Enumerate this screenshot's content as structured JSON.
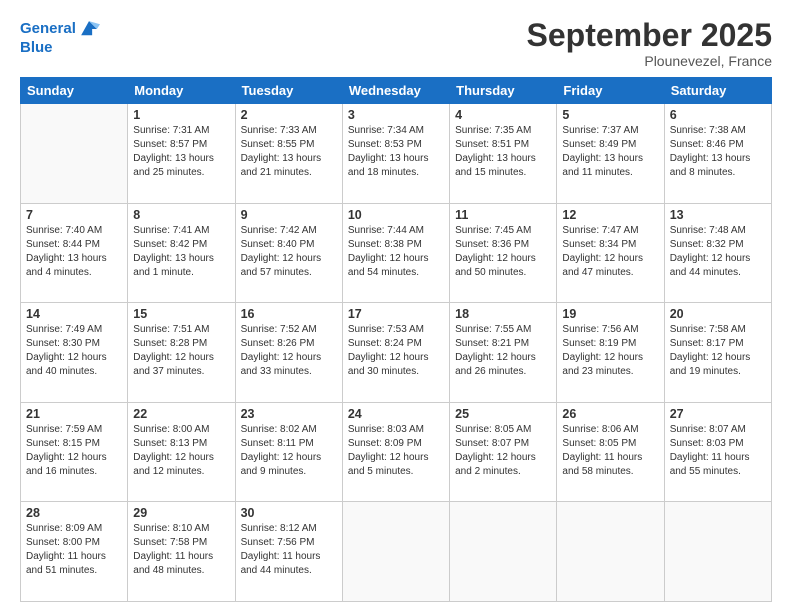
{
  "header": {
    "logo_line1": "General",
    "logo_line2": "Blue",
    "month": "September 2025",
    "location": "Plounevezel, France"
  },
  "days_of_week": [
    "Sunday",
    "Monday",
    "Tuesday",
    "Wednesday",
    "Thursday",
    "Friday",
    "Saturday"
  ],
  "weeks": [
    [
      {
        "day": "",
        "info": ""
      },
      {
        "day": "1",
        "info": "Sunrise: 7:31 AM\nSunset: 8:57 PM\nDaylight: 13 hours and 25 minutes."
      },
      {
        "day": "2",
        "info": "Sunrise: 7:33 AM\nSunset: 8:55 PM\nDaylight: 13 hours and 21 minutes."
      },
      {
        "day": "3",
        "info": "Sunrise: 7:34 AM\nSunset: 8:53 PM\nDaylight: 13 hours and 18 minutes."
      },
      {
        "day": "4",
        "info": "Sunrise: 7:35 AM\nSunset: 8:51 PM\nDaylight: 13 hours and 15 minutes."
      },
      {
        "day": "5",
        "info": "Sunrise: 7:37 AM\nSunset: 8:49 PM\nDaylight: 13 hours and 11 minutes."
      },
      {
        "day": "6",
        "info": "Sunrise: 7:38 AM\nSunset: 8:46 PM\nDaylight: 13 hours and 8 minutes."
      }
    ],
    [
      {
        "day": "7",
        "info": "Sunrise: 7:40 AM\nSunset: 8:44 PM\nDaylight: 13 hours and 4 minutes."
      },
      {
        "day": "8",
        "info": "Sunrise: 7:41 AM\nSunset: 8:42 PM\nDaylight: 13 hours and 1 minute."
      },
      {
        "day": "9",
        "info": "Sunrise: 7:42 AM\nSunset: 8:40 PM\nDaylight: 12 hours and 57 minutes."
      },
      {
        "day": "10",
        "info": "Sunrise: 7:44 AM\nSunset: 8:38 PM\nDaylight: 12 hours and 54 minutes."
      },
      {
        "day": "11",
        "info": "Sunrise: 7:45 AM\nSunset: 8:36 PM\nDaylight: 12 hours and 50 minutes."
      },
      {
        "day": "12",
        "info": "Sunrise: 7:47 AM\nSunset: 8:34 PM\nDaylight: 12 hours and 47 minutes."
      },
      {
        "day": "13",
        "info": "Sunrise: 7:48 AM\nSunset: 8:32 PM\nDaylight: 12 hours and 44 minutes."
      }
    ],
    [
      {
        "day": "14",
        "info": "Sunrise: 7:49 AM\nSunset: 8:30 PM\nDaylight: 12 hours and 40 minutes."
      },
      {
        "day": "15",
        "info": "Sunrise: 7:51 AM\nSunset: 8:28 PM\nDaylight: 12 hours and 37 minutes."
      },
      {
        "day": "16",
        "info": "Sunrise: 7:52 AM\nSunset: 8:26 PM\nDaylight: 12 hours and 33 minutes."
      },
      {
        "day": "17",
        "info": "Sunrise: 7:53 AM\nSunset: 8:24 PM\nDaylight: 12 hours and 30 minutes."
      },
      {
        "day": "18",
        "info": "Sunrise: 7:55 AM\nSunset: 8:21 PM\nDaylight: 12 hours and 26 minutes."
      },
      {
        "day": "19",
        "info": "Sunrise: 7:56 AM\nSunset: 8:19 PM\nDaylight: 12 hours and 23 minutes."
      },
      {
        "day": "20",
        "info": "Sunrise: 7:58 AM\nSunset: 8:17 PM\nDaylight: 12 hours and 19 minutes."
      }
    ],
    [
      {
        "day": "21",
        "info": "Sunrise: 7:59 AM\nSunset: 8:15 PM\nDaylight: 12 hours and 16 minutes."
      },
      {
        "day": "22",
        "info": "Sunrise: 8:00 AM\nSunset: 8:13 PM\nDaylight: 12 hours and 12 minutes."
      },
      {
        "day": "23",
        "info": "Sunrise: 8:02 AM\nSunset: 8:11 PM\nDaylight: 12 hours and 9 minutes."
      },
      {
        "day": "24",
        "info": "Sunrise: 8:03 AM\nSunset: 8:09 PM\nDaylight: 12 hours and 5 minutes."
      },
      {
        "day": "25",
        "info": "Sunrise: 8:05 AM\nSunset: 8:07 PM\nDaylight: 12 hours and 2 minutes."
      },
      {
        "day": "26",
        "info": "Sunrise: 8:06 AM\nSunset: 8:05 PM\nDaylight: 11 hours and 58 minutes."
      },
      {
        "day": "27",
        "info": "Sunrise: 8:07 AM\nSunset: 8:03 PM\nDaylight: 11 hours and 55 minutes."
      }
    ],
    [
      {
        "day": "28",
        "info": "Sunrise: 8:09 AM\nSunset: 8:00 PM\nDaylight: 11 hours and 51 minutes."
      },
      {
        "day": "29",
        "info": "Sunrise: 8:10 AM\nSunset: 7:58 PM\nDaylight: 11 hours and 48 minutes."
      },
      {
        "day": "30",
        "info": "Sunrise: 8:12 AM\nSunset: 7:56 PM\nDaylight: 11 hours and 44 minutes."
      },
      {
        "day": "",
        "info": ""
      },
      {
        "day": "",
        "info": ""
      },
      {
        "day": "",
        "info": ""
      },
      {
        "day": "",
        "info": ""
      }
    ]
  ]
}
